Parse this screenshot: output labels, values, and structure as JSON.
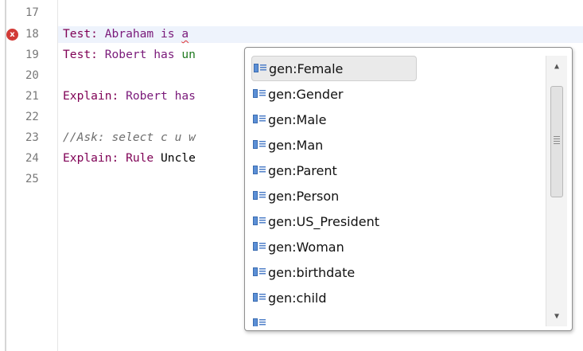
{
  "editor": {
    "line_numbers": [
      "17",
      "18",
      "19",
      "20",
      "21",
      "22",
      "23",
      "24",
      "25"
    ],
    "lines": {
      "l18_kw": "Test: ",
      "l18_text": "Abraham is ",
      "l18_err": "a",
      "l19_kw": "Test: ",
      "l19_text": "Robert has ",
      "l19_green": "un",
      "l21_kw": "Explain: ",
      "l21_text": "Robert has",
      "l23_comment": "//Ask: select c u w",
      "l24_kw": "Explain: ",
      "l24_rule": "Rule ",
      "l24_text": "Uncle"
    },
    "error_marker": "x"
  },
  "autocomplete": {
    "items": [
      {
        "label": "gen:Female",
        "selected": true
      },
      {
        "label": "gen:Gender"
      },
      {
        "label": "gen:Male"
      },
      {
        "label": "gen:Man"
      },
      {
        "label": "gen:Parent"
      },
      {
        "label": "gen:Person"
      },
      {
        "label": "gen:US_President"
      },
      {
        "label": "gen:Woman"
      },
      {
        "label": "gen:birthdate"
      },
      {
        "label": "gen:child"
      }
    ],
    "scroll_up": "▲",
    "scroll_down": "▼"
  }
}
